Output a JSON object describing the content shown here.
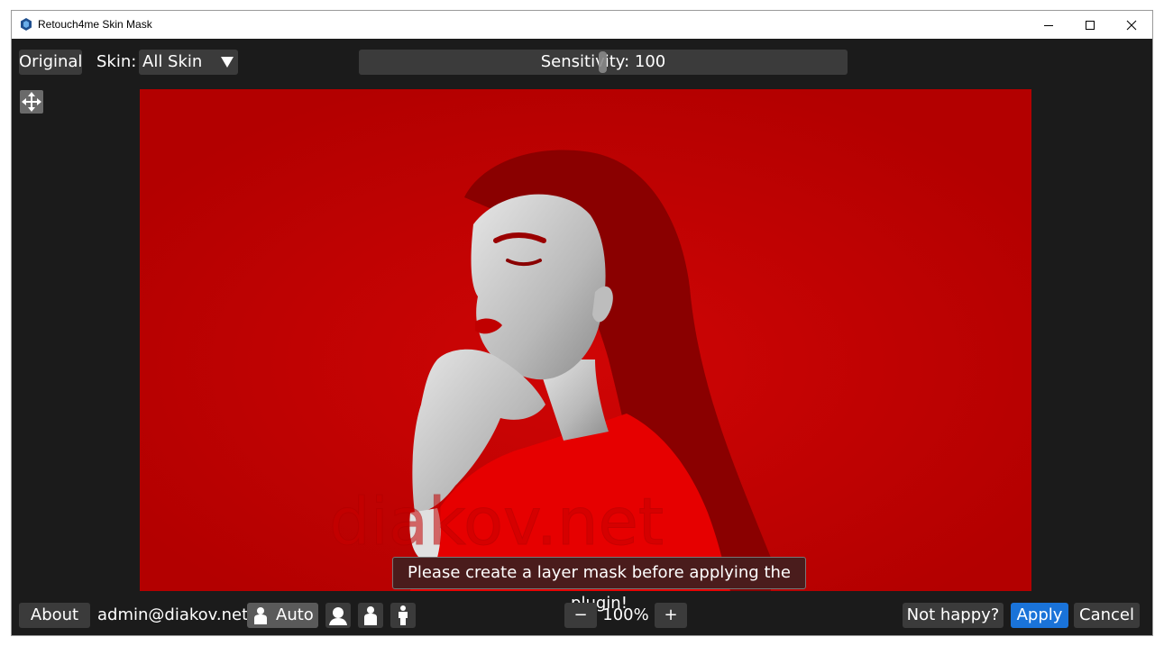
{
  "window": {
    "title": "Retouch4me Skin Mask",
    "controls": {
      "minimize": "minimize-icon",
      "maximize": "maximize-icon",
      "close": "close-icon"
    }
  },
  "toolbar": {
    "original_label": "Original",
    "skin_label": "Skin:",
    "skin_value": "All Skin",
    "sensitivity_text": "Sensitivity: 100",
    "sensitivity_value": 100
  },
  "canvas": {
    "overlay_color": "#c20000",
    "watermark": "diakov.net"
  },
  "notice": "Please create a layer mask before applying the plugin!",
  "bottom": {
    "about_label": "About",
    "user": "admin@diakov.net",
    "auto_label": "Auto",
    "modes": [
      "auto-person-icon",
      "face-icon",
      "upper-body-icon",
      "full-body-icon"
    ],
    "zoom_minus": "−",
    "zoom": "100%",
    "zoom_plus": "+",
    "not_happy_label": "Not happy?",
    "apply_label": "Apply",
    "cancel_label": "Cancel"
  },
  "colors": {
    "accent": "#1a73d9",
    "background": "#1b1b1b",
    "button": "#3b3b3b"
  }
}
